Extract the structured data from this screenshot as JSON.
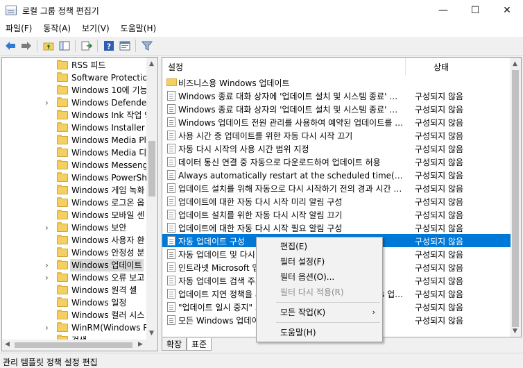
{
  "window": {
    "title": "로컬 그룹 정책 편집기",
    "btn_min": "—",
    "btn_max": "☐",
    "btn_close": "✕"
  },
  "menu": [
    "파일(F)",
    "동작(A)",
    "보기(V)",
    "도움말(H)"
  ],
  "tree": {
    "items": [
      {
        "label": "RSS 피드",
        "expandable": false
      },
      {
        "label": "Software Protection",
        "expandable": false
      },
      {
        "label": "Windows 10에 기능",
        "expandable": false
      },
      {
        "label": "Windows Defender S",
        "expandable": true
      },
      {
        "label": "Windows Ink 작업 영",
        "expandable": false
      },
      {
        "label": "Windows Installer",
        "expandable": false
      },
      {
        "label": "Windows Media Play",
        "expandable": false
      },
      {
        "label": "Windows Media 디지",
        "expandable": false
      },
      {
        "label": "Windows Messenger",
        "expandable": false
      },
      {
        "label": "Windows PowerShel",
        "expandable": false
      },
      {
        "label": "Windows 게임 녹화",
        "expandable": false
      },
      {
        "label": "Windows 로그온 옵",
        "expandable": false
      },
      {
        "label": "Windows 모바일 센",
        "expandable": false
      },
      {
        "label": "Windows 보안",
        "expandable": true
      },
      {
        "label": "Windows 사용자 환",
        "expandable": false
      },
      {
        "label": "Windows 안정성 분",
        "expandable": false
      },
      {
        "label": "Windows 업데이트",
        "expandable": true,
        "selected": true
      },
      {
        "label": "Windows 오류 보고",
        "expandable": true
      },
      {
        "label": "Windows 원격 셸",
        "expandable": false
      },
      {
        "label": "Windows 일정",
        "expandable": false
      },
      {
        "label": "Windows 컬러 시스",
        "expandable": false
      },
      {
        "label": "WinRM(Windows Re",
        "expandable": true
      },
      {
        "label": "검색",
        "expandable": false
      }
    ]
  },
  "list": {
    "col_setting": "설정",
    "col_state": "상태",
    "rows": [
      {
        "type": "folder",
        "name": "비즈니스용 Windows 업데이트",
        "state": ""
      },
      {
        "type": "setting",
        "name": "Windows 종료 대화 상자에 '업데이트 설치 및 시스템 종료' 옵션 표시 안 함",
        "state": "구성되지 않음"
      },
      {
        "type": "setting",
        "name": "Windows 종료 대화 상자의 '업데이트 설치 및 시스템 종료' 기본 옵션을 조정하지 않음",
        "state": "구성되지 않음"
      },
      {
        "type": "setting",
        "name": "Windows 업데이트 전원 관리를 사용하여 예약된 업데이트를 설치하도록 시스템 절전 모드 해제",
        "state": "구성되지 않음"
      },
      {
        "type": "setting",
        "name": "사용 시간 중 업데이트를 위한 자동 다시 시작 끄기",
        "state": "구성되지 않음"
      },
      {
        "type": "setting",
        "name": "자동 다시 시작의 사용 시간 범위 지정",
        "state": "구성되지 않음"
      },
      {
        "type": "setting",
        "name": "데이터 통신 연결 중 자동으로 다운로드하여 업데이트 허용",
        "state": "구성되지 않음"
      },
      {
        "type": "setting",
        "name": "Always automatically restart at the scheduled time(항상 예약된 시간에 자동으로 다시 시작)",
        "state": "구성되지 않음"
      },
      {
        "type": "setting",
        "name": "업데이트 설치를 위해 자동으로 다시 시작하기 전의 경과 시간 지정",
        "state": "구성되지 않음"
      },
      {
        "type": "setting",
        "name": "업데이트에 대한 자동 다시 시작 미리 알림 구성",
        "state": "구성되지 않음"
      },
      {
        "type": "setting",
        "name": "업데이트 설치를 위한 자동 다시 시작 알림 끄기",
        "state": "구성되지 않음"
      },
      {
        "type": "setting",
        "name": "업데이트에 대한 자동 다시 시작 필요 알림 구성",
        "state": "구성되지 않음"
      },
      {
        "type": "setting",
        "name": "자동 업데이트 구성",
        "state": "구성되지 않음",
        "selected": true
      },
      {
        "type": "setting",
        "name": "자동 업데이트 및 다시 시작",
        "state": "구성되지 않음"
      },
      {
        "type": "setting",
        "name": "인트라넷 Microsoft 업데이트 서비스 위치 지정",
        "state": "구성되지 않음"
      },
      {
        "type": "setting",
        "name": "자동 업데이트 검색 주기",
        "state": "구성되지 않음"
      },
      {
        "type": "setting",
        "name": "업데이트 지연 정책을 사용하지 않도록 설정하여 Windows 업데이트 검사",
        "state": "구성되지 않음"
      },
      {
        "type": "setting",
        "name": "\"업데이트 일시 중지\" 기능에 대한 액세스 제거",
        "state": "구성되지 않음"
      },
      {
        "type": "setting",
        "name": "모든 Windows 업데이트 기능에 대한 액세스 제거",
        "state": "구성되지 않음"
      }
    ]
  },
  "context_menu": {
    "edit": "편집(E)",
    "filter_on": "필터 설정(F)",
    "filter_options": "필터 옵션(O)...",
    "filter_reapply": "필터 다시 적용(R)",
    "all_tasks": "모든 작업(K)",
    "help": "도움말(H)"
  },
  "tabs": {
    "extended": "확장",
    "standard": "표준"
  },
  "status": "관리 템플릿 정책 설정 편집"
}
